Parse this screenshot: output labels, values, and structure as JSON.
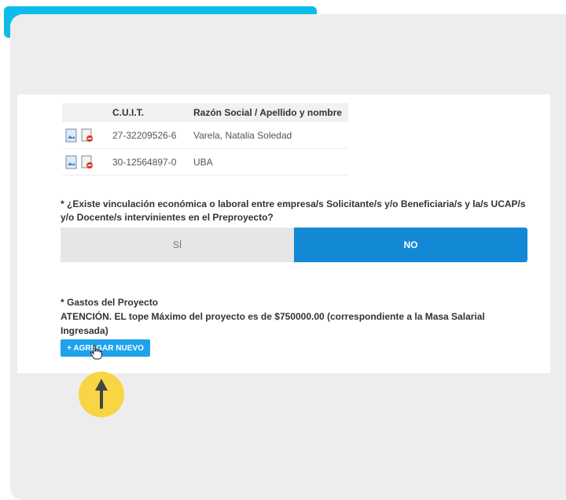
{
  "table": {
    "headers": [
      "",
      "C.U.I.T.",
      "Razón Social / Apellido y nombre"
    ],
    "rows": [
      {
        "cuit": "27-32209526-6",
        "razon": "Varela, Natalia Soledad"
      },
      {
        "cuit": "30-12564897-0",
        "razon": "UBA"
      }
    ]
  },
  "question": {
    "text": "* ¿Existe vinculación económica o laboral entre empresa/s Solicitante/s y/o Beneficiaria/s y la/s UCAP/s y/o Docente/s intervinientes en el Preproyecto?",
    "option_si": "SÍ",
    "option_no": "NO",
    "selected": "NO"
  },
  "gastos": {
    "title": "* Gastos del Proyecto",
    "notice": "ATENCIÓN. EL tope Máximo del proyecto es de $750000.00 (correspondiente a la Masa Salarial Ingresada)",
    "add_label": "+ AGREGAR NUEVO"
  },
  "colors": {
    "accent": "#1389d6",
    "button": "#1da3ec",
    "top_bar": "#0bbde8",
    "badge": "#f7d544"
  },
  "icons": [
    "view-document-icon",
    "delete-document-icon",
    "hand-cursor-icon",
    "up-arrow-icon"
  ]
}
